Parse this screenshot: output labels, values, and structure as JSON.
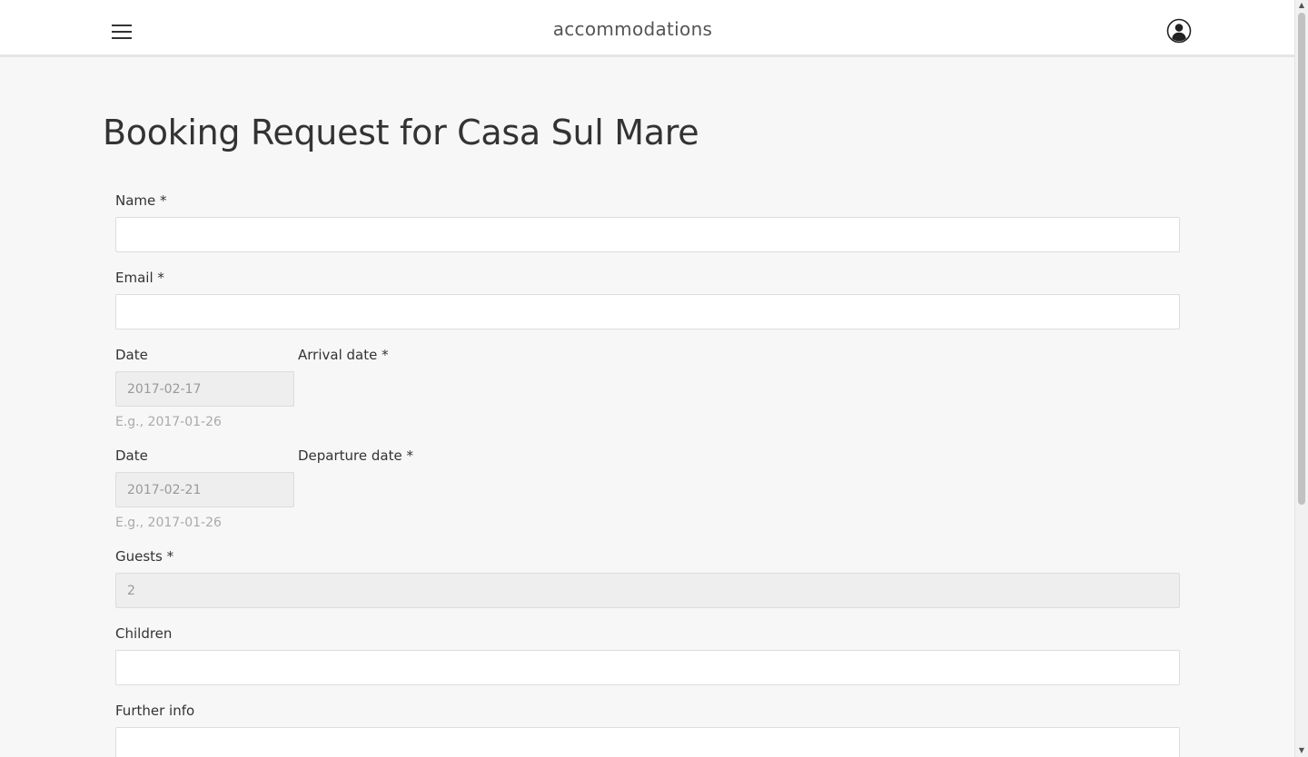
{
  "header": {
    "brand": "accommodations",
    "menu_icon": "hamburger-menu-icon",
    "user_icon": "user-account-icon"
  },
  "page": {
    "title": "Booking Request for Casa Sul Mare"
  },
  "form": {
    "name": {
      "label": "Name *",
      "value": ""
    },
    "email": {
      "label": "Email *",
      "value": ""
    },
    "arrival": {
      "date_label": "Date",
      "label": "Arrival date *",
      "value": "2017-02-17",
      "hint": "E.g., 2017-01-26"
    },
    "departure": {
      "date_label": "Date",
      "label": "Departure date *",
      "value": "2017-02-21",
      "hint": "E.g., 2017-01-26"
    },
    "guests": {
      "label": "Guests *",
      "value": "2"
    },
    "children": {
      "label": "Children",
      "value": ""
    },
    "further_info": {
      "label": "Further info",
      "value": ""
    }
  },
  "colors": {
    "background": "#f7f7f7",
    "topbar": "#ffffff",
    "disabled_field": "#eeeeee",
    "hint_text": "#aaaaaa"
  }
}
